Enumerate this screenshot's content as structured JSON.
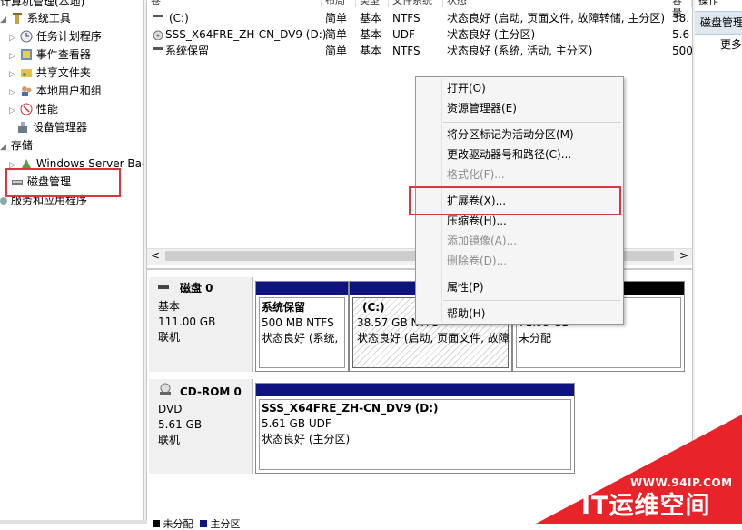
{
  "tree": {
    "top_item": "计算机管理(本地)",
    "items": [
      {
        "label": "系统工具"
      },
      {
        "label": "任务计划程序"
      },
      {
        "label": "事件查看器"
      },
      {
        "label": "共享文件夹"
      },
      {
        "label": "本地用户和组"
      },
      {
        "label": "性能"
      },
      {
        "label": "设备管理器"
      },
      {
        "label": "存储"
      },
      {
        "label": "Windows Server Back"
      },
      {
        "label": "磁盘管理"
      },
      {
        "label": "服务和应用程序"
      }
    ]
  },
  "volume_list": {
    "headers": [
      "卷",
      "布局",
      "类型",
      "文件系统",
      "状态",
      "容量"
    ],
    "rows": [
      {
        "name": "(C:)",
        "layout": "简单",
        "type": "基本",
        "fs": "NTFS",
        "status": "状态良好 (启动, 页面文件, 故障转储, 主分区)",
        "cap": "38."
      },
      {
        "name": "SSS_X64FRE_ZH-CN_DV9 (D:)",
        "layout": "简单",
        "type": "基本",
        "fs": "UDF",
        "status": "状态良好 (主分区)",
        "cap": "5.6"
      },
      {
        "name": "系统保留",
        "layout": "简单",
        "type": "基本",
        "fs": "NTFS",
        "status": "状态良好 (系统, 活动, 主分区)",
        "cap": "500"
      }
    ],
    "scroll_left": "<",
    "scroll_right": ">"
  },
  "actions": {
    "header": "操作",
    "title": "磁盘管理",
    "more": "更多"
  },
  "disks": {
    "disk0": {
      "name": "磁盘 0",
      "type": "基本",
      "size": "111.00 GB",
      "status": "联机",
      "partitions": [
        {
          "name": "系统保留",
          "detail": "500 MB NTFS",
          "status": "状态良好 (系统, 活"
        },
        {
          "name": "(C:)",
          "detail": "38.57 GB NTFS",
          "status": "状态良好 (启动, 页面文件, 故障"
        },
        {
          "name": "",
          "detail": "71.93 GB",
          "status": "未分配"
        }
      ]
    },
    "cdrom0": {
      "name": "CD-ROM 0",
      "type": "DVD",
      "size": "5.61 GB",
      "status": "联机",
      "partition": {
        "name": "SSS_X64FRE_ZH-CN_DV9  (D:)",
        "detail": "5.61 GB UDF",
        "status": "状态良好 (主分区)"
      }
    },
    "legend": [
      "未分配",
      "主分区"
    ]
  },
  "context_menu": {
    "items": [
      {
        "label": "打开(O)",
        "disabled": false
      },
      {
        "label": "资源管理器(E)",
        "disabled": false
      },
      {
        "label": "将分区标记为活动分区(M)",
        "disabled": false
      },
      {
        "label": "更改驱动器号和路径(C)...",
        "disabled": false
      },
      {
        "label": "格式化(F)...",
        "disabled": true
      },
      {
        "label": "扩展卷(X)...",
        "disabled": false
      },
      {
        "label": "压缩卷(H)...",
        "disabled": false
      },
      {
        "label": "添加镜像(A)...",
        "disabled": true
      },
      {
        "label": "删除卷(D)...",
        "disabled": true
      },
      {
        "label": "属性(P)",
        "disabled": false
      },
      {
        "label": "帮助(H)",
        "disabled": false
      }
    ]
  },
  "watermark": {
    "url": "WWW.94IP.COM",
    "brand": "IT运维空间"
  },
  "colors": {
    "partition_bar": "#0d1480",
    "highlight": "#d9363e",
    "watermark_red": "#e8232a"
  }
}
